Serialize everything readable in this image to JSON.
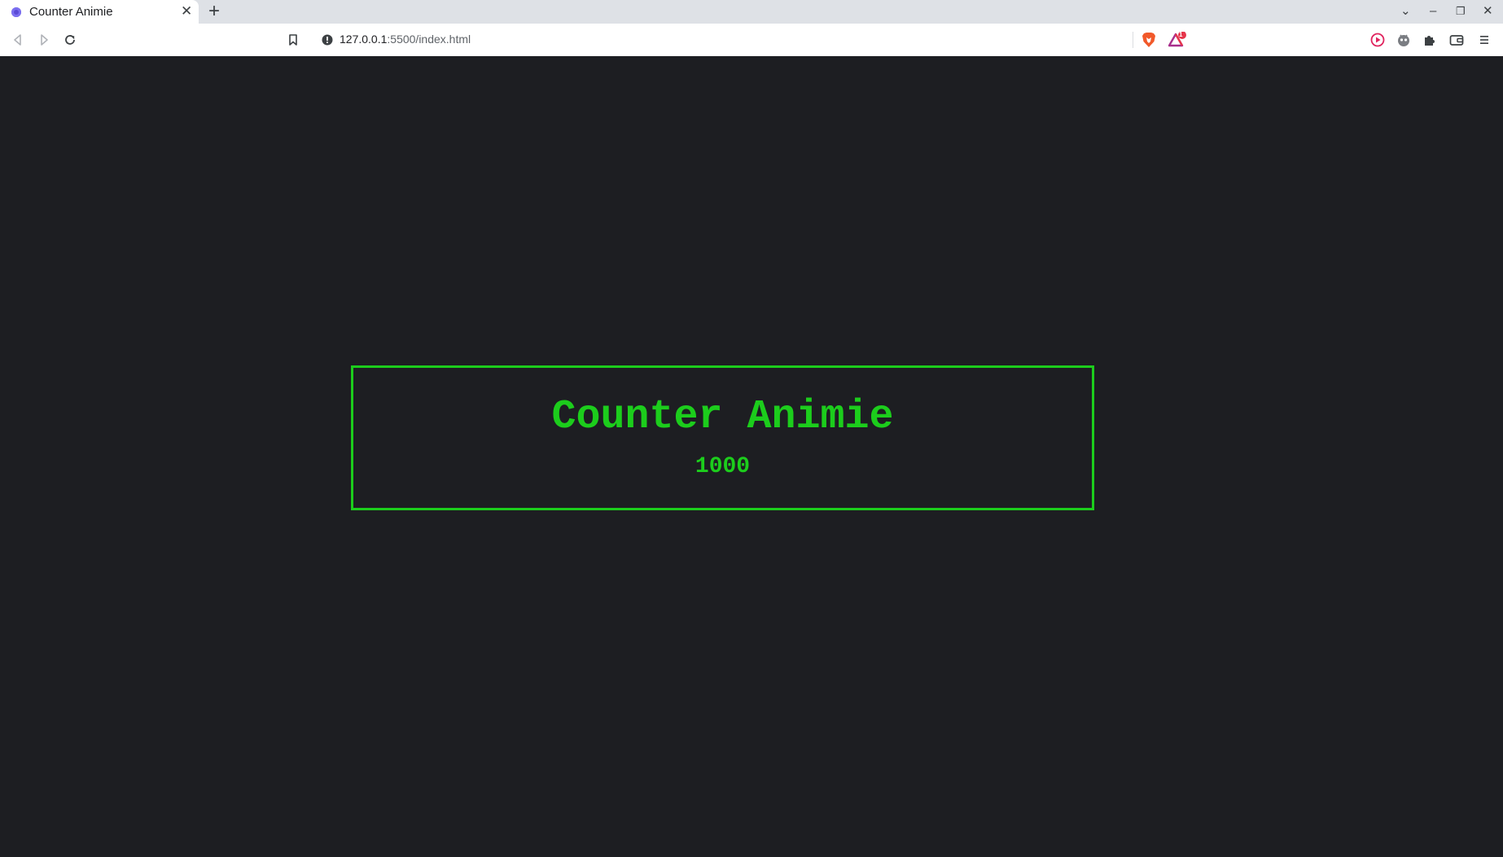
{
  "browser": {
    "tab": {
      "title": "Counter Animie",
      "close_glyph": "✕"
    },
    "new_tab_glyph": "+",
    "window_controls": {
      "tab_search_glyph": "⌄",
      "minimize_glyph": "–",
      "restore_glyph": "❐",
      "close_glyph": "✕"
    },
    "address_bar": {
      "url_host": "127.0.0.1",
      "url_rest": ":5500/index.html"
    },
    "shields_badge_count": "1",
    "icons": {
      "back": "back-arrow-icon",
      "forward": "forward-arrow-icon",
      "reload": "reload-icon",
      "bookmark": "bookmark-icon",
      "site_info": "info-icon",
      "brave_shields": "brave-lion-icon",
      "rewards": "rewards-triangle-icon",
      "media": "play-circle-icon",
      "extension_avatar": "extension-avatar-icon",
      "extensions": "puzzle-icon",
      "wallet": "wallet-icon",
      "menu": "hamburger-menu-icon"
    }
  },
  "page": {
    "title": "Counter Animie",
    "counter_value": "1000"
  },
  "colors": {
    "page_background": "#1d1e22",
    "accent_green": "#1ccd1c"
  }
}
